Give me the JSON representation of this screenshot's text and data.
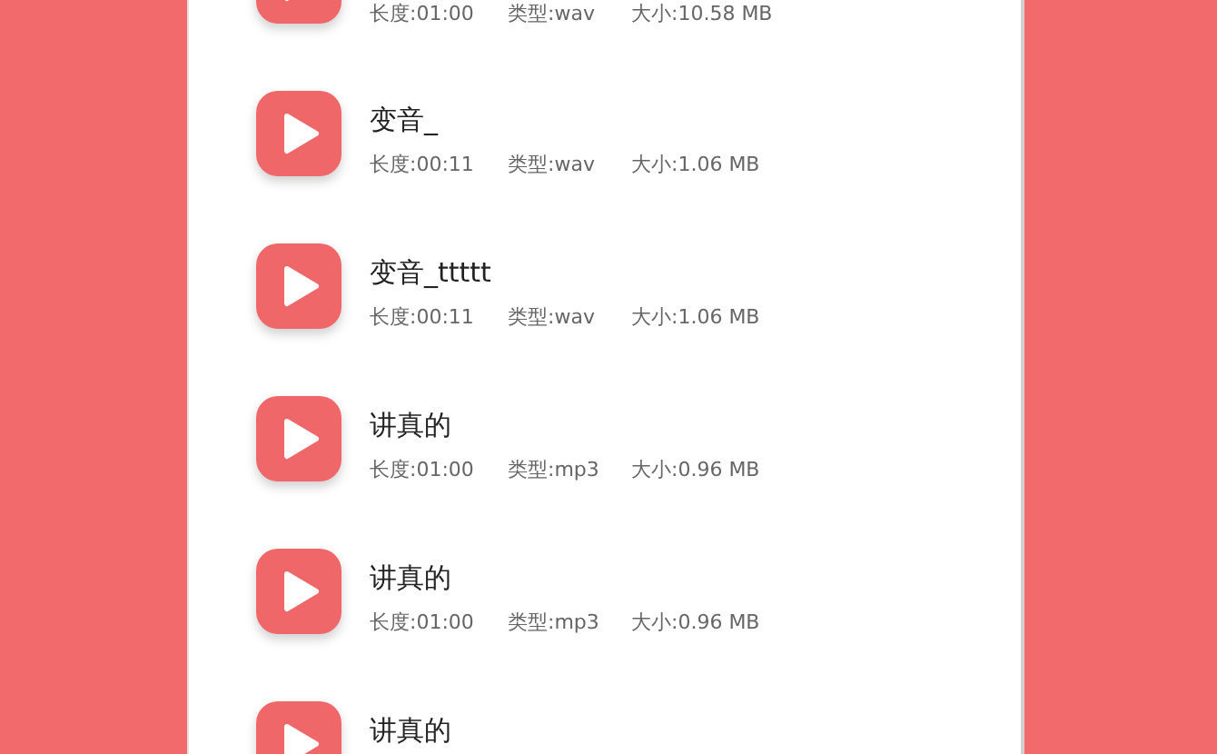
{
  "recordings": [
    {
      "duration": "长度:01:00",
      "type": "类型:wav",
      "size": "大小:10.58 MB"
    },
    {
      "title": "变音_",
      "duration": "长度:00:11",
      "type": "类型:wav",
      "size": "大小:1.06 MB"
    },
    {
      "title": "变音_ttttt",
      "duration": "长度:00:11",
      "type": "类型:wav",
      "size": "大小:1.06 MB"
    },
    {
      "title": "讲真的",
      "duration": "长度:01:00",
      "type": "类型:mp3",
      "size": "大小:0.96 MB"
    },
    {
      "title": "讲真的",
      "duration": "长度:01:00",
      "type": "类型:mp3",
      "size": "大小:0.96 MB"
    },
    {
      "title": "讲真的"
    }
  ]
}
